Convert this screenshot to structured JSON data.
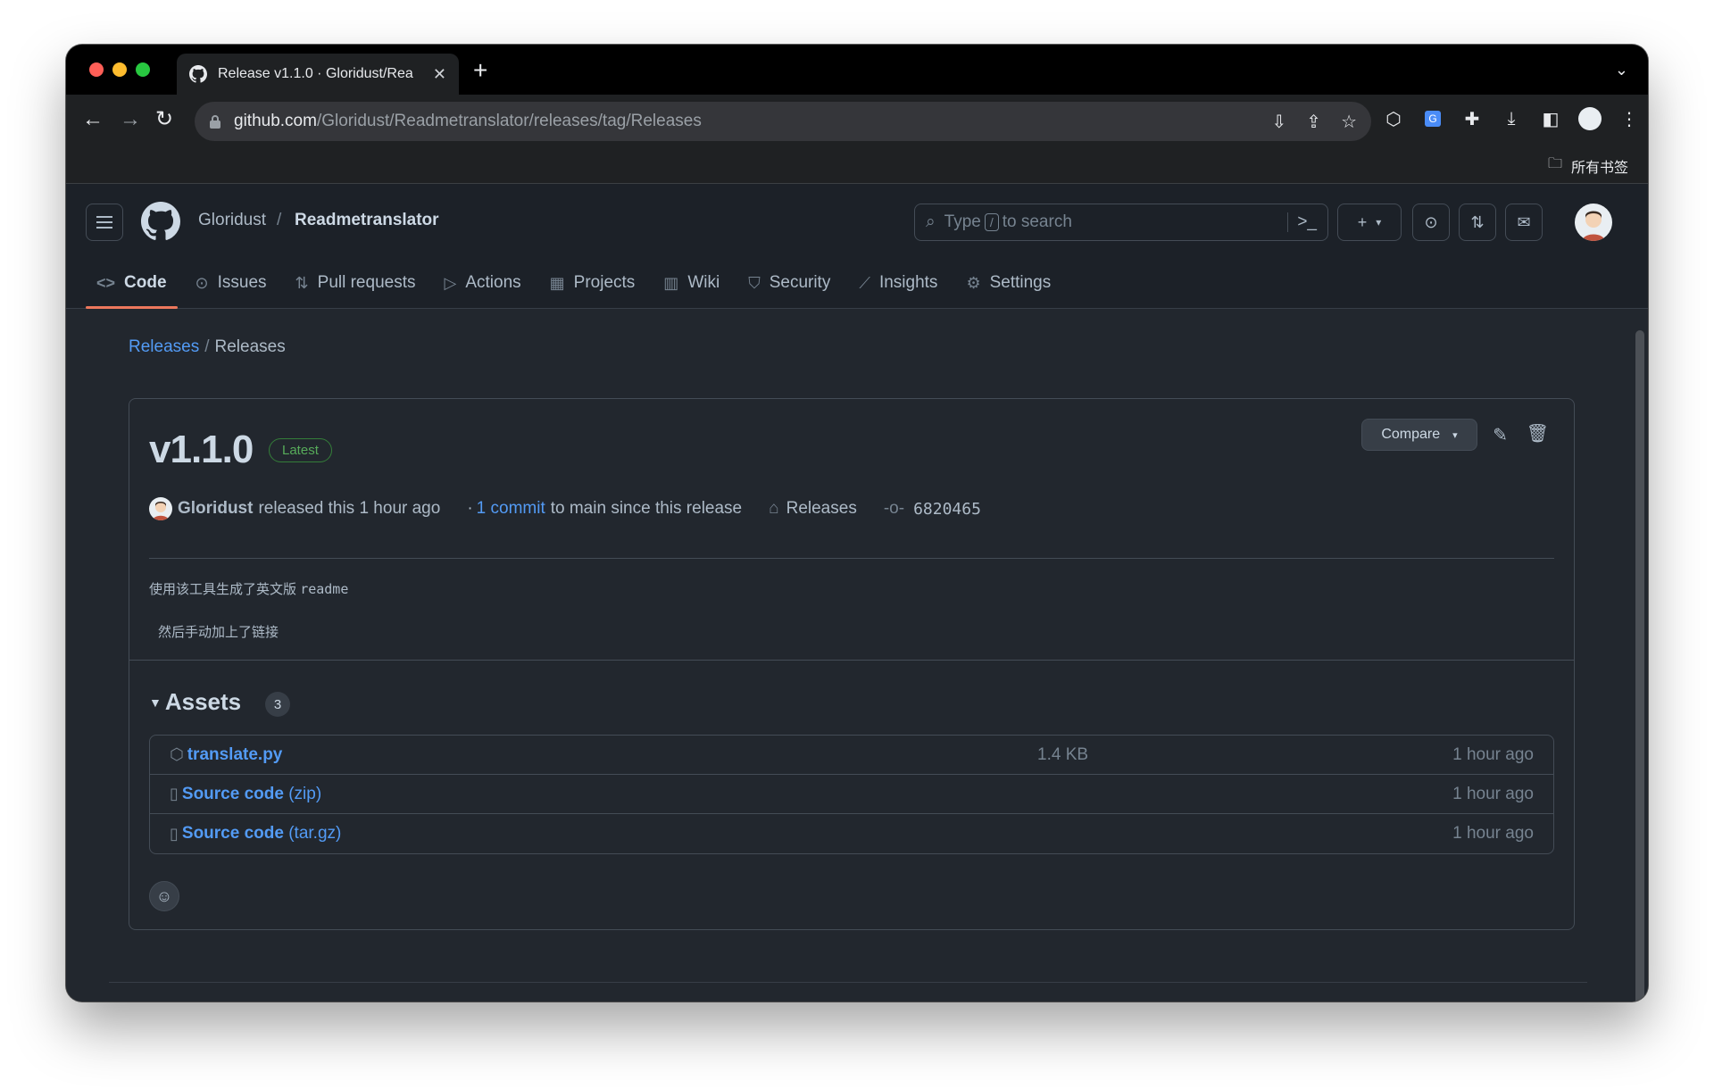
{
  "browser": {
    "tab_title": "Release v1.1.0 · Gloridust/Rea",
    "tab_close": "✕",
    "new_tab": "+",
    "url_host": "github.com",
    "url_path": "/Gloridust/Readmetranslator/releases/tag/Releases",
    "bookmarks_folder": "所有书签"
  },
  "header": {
    "owner": "Gloridust",
    "separator": "/",
    "repo": "Readmetranslator",
    "search_prefix": "Type",
    "search_key": "/",
    "search_suffix": "to search",
    "plus": "+"
  },
  "repo_nav": [
    {
      "label": "Code",
      "icon": "code-icon"
    },
    {
      "label": "Issues",
      "icon": "issue-icon"
    },
    {
      "label": "Pull requests",
      "icon": "pull-request-icon"
    },
    {
      "label": "Actions",
      "icon": "play-icon"
    },
    {
      "label": "Projects",
      "icon": "table-icon"
    },
    {
      "label": "Wiki",
      "icon": "book-icon"
    },
    {
      "label": "Security",
      "icon": "shield-icon"
    },
    {
      "label": "Insights",
      "icon": "graph-icon"
    },
    {
      "label": "Settings",
      "icon": "gear-icon"
    }
  ],
  "breadcrumb": {
    "link": "Releases",
    "current": "Releases"
  },
  "release": {
    "title": "v1.1.0",
    "badge": "Latest",
    "compare_label": "Compare",
    "author": "Gloridust",
    "released_text": "released this 1 hour ago",
    "dot": "·",
    "commit_link": "1 commit",
    "commit_text": "to main since this release",
    "tag": "Releases",
    "sha": "6820465",
    "body_line1_cn": "使用该工具生成了英文版",
    "body_line1_code": "readme",
    "body_line2": "然后手动加上了链接"
  },
  "assets": {
    "title": "Assets",
    "count": "3",
    "items": [
      {
        "name": "translate.py",
        "suffix": "",
        "size": "1.4 KB",
        "time": "1 hour ago"
      },
      {
        "name": "Source code",
        "suffix": "(zip)",
        "size": "",
        "time": "1 hour ago"
      },
      {
        "name": "Source code",
        "suffix": "(tar.gz)",
        "size": "",
        "time": "1 hour ago"
      }
    ]
  }
}
